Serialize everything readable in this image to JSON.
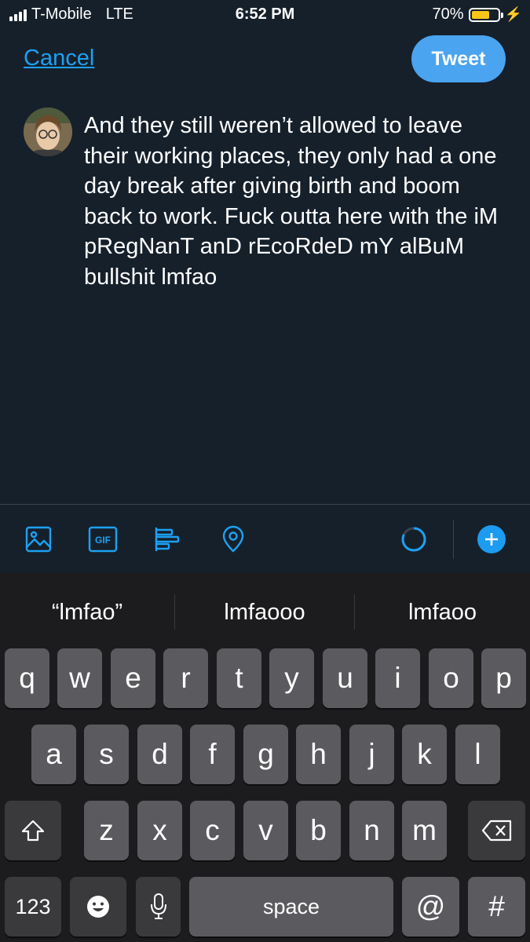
{
  "status_bar": {
    "carrier": "T-Mobile",
    "network": "LTE",
    "time": "6:52 PM",
    "battery_percent": "70%",
    "battery_level": 0.7
  },
  "header": {
    "cancel_label": "Cancel",
    "tweet_label": "Tweet"
  },
  "compose": {
    "text": "And they still weren’t allowed to leave their working places, they only had a one day break after giving birth and boom back to work. Fuck outta here with the iM pRegNanT anD rEcoRdeD mY alBuM bullshit lmfao"
  },
  "toolbar": {
    "items": [
      "image-icon",
      "gif-icon",
      "poll-icon",
      "location-icon",
      "character-count-ring",
      "add-tweet-icon"
    ],
    "gif_label": "GIF"
  },
  "keyboard": {
    "suggestions": [
      "“lmfao”",
      "lmfaooo",
      "lmfaoo"
    ],
    "row1": [
      "q",
      "w",
      "e",
      "r",
      "t",
      "y",
      "u",
      "i",
      "o",
      "p"
    ],
    "row2": [
      "a",
      "s",
      "d",
      "f",
      "g",
      "h",
      "j",
      "k",
      "l"
    ],
    "row3": [
      "z",
      "x",
      "c",
      "v",
      "b",
      "n",
      "m"
    ],
    "numbers_label": "123",
    "space_label": "space",
    "at_label": "@",
    "hash_label": "#"
  },
  "colors": {
    "background": "#15202b",
    "accent": "#1da1f2",
    "tweet_button": "#4aa4ef",
    "keyboard_bg": "#1c1c1e",
    "key_bg": "#5b5b5f"
  }
}
